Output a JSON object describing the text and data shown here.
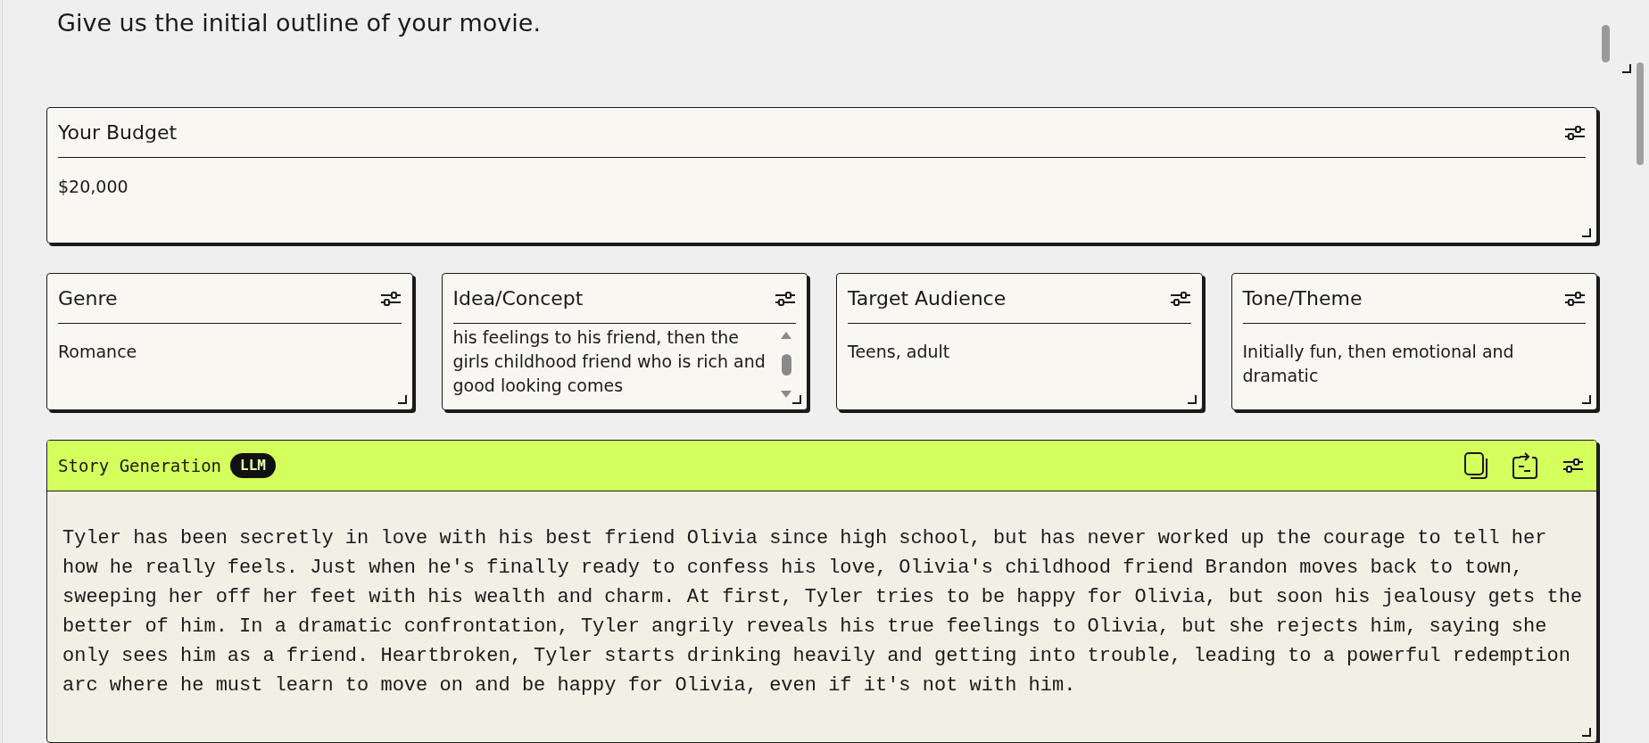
{
  "intro": {
    "text": "Give us the initial outline of your movie."
  },
  "budget": {
    "title": "Your Budget",
    "value": "$20,000"
  },
  "fields": [
    {
      "title": "Genre",
      "lines": [
        "Romance"
      ],
      "scrollable": false
    },
    {
      "title": "Idea/Concept",
      "lines": [
        "his feelings to his friend, then the",
        "girls childhood friend who is rich and",
        "good looking comes"
      ],
      "scrollable": true
    },
    {
      "title": "Target Audience",
      "lines": [
        "Teens, adult"
      ],
      "scrollable": false
    },
    {
      "title": "Tone/Theme",
      "lines": [
        "Initially fun, then emotional and dramatic"
      ],
      "scrollable": false
    }
  ],
  "story": {
    "title": "Story Generation",
    "badge": "LLM",
    "text": "Tyler has been secretly in love with his best friend Olivia since high school, but has never worked up the courage to tell her how he really feels. Just when he's finally ready to confess his love, Olivia's childhood friend Brandon moves back to town, sweeping her off her feet with his wealth and charm. At first, Tyler tries to be happy for Olivia, but soon his jealousy gets the better of him. In a dramatic confrontation, Tyler angrily reveals his true feelings to Olivia, but she rejects him, saying she only sees him as a friend. Heartbroken, Tyler starts drinking heavily and getting into trouble, leading to a powerful redemption arc where he must learn to move on and be happy for Olivia, even if it's not with him."
  }
}
